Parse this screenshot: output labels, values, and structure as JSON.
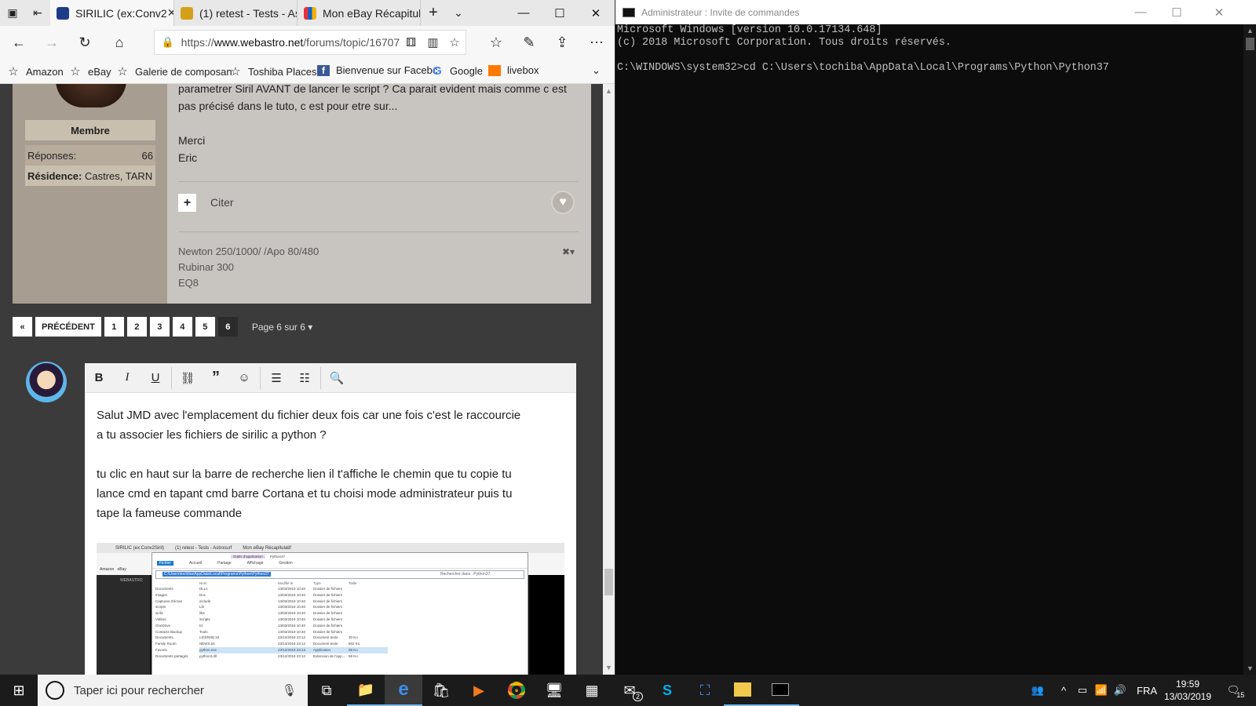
{
  "edge": {
    "tabs": [
      {
        "label": "SIRILIC (ex:Conv2",
        "color": "#1e3a8a"
      },
      {
        "label": "(1) retest - Tests - As",
        "color": "#d4a017"
      },
      {
        "label": "Mon eBay Récapitula",
        "color": "#e53238"
      }
    ],
    "url_prefix": "https://",
    "url_host": "www.webastro.net",
    "url_path": "/forums/topic/16707",
    "favorites": [
      {
        "label": "Amazon",
        "icon": "star-icon"
      },
      {
        "label": "eBay",
        "icon": "star-icon"
      },
      {
        "label": "Galerie de composan",
        "icon": "star-icon"
      },
      {
        "label": "Toshiba Places",
        "icon": "star-icon"
      },
      {
        "label": "Bienvenue sur Facebc",
        "icon": "facebook-icon"
      },
      {
        "label": "Google",
        "icon": "google-icon"
      },
      {
        "label": "livebox",
        "icon": "orange-icon"
      }
    ]
  },
  "post": {
    "role": "Membre",
    "replies_label": "Réponses:",
    "replies_count": "66",
    "residence_label": "Résidence:",
    "residence_value": "Castres, TARN",
    "line1": "parametrer Siril AVANT de lancer le script ? Ca parait evident mais comme c est",
    "line2": "pas précisé dans le tuto, c est pour etre sur...",
    "line3": "Merci",
    "line4": "Eric",
    "citer": "Citer",
    "sig1": "Newton 250/1000/  /Apo 80/480",
    "sig2": "Rubinar 300",
    "sig3": "EQ8"
  },
  "pager": {
    "first": "«",
    "prev": "PRÉCÉDENT",
    "pages": [
      "1",
      "2",
      "3",
      "4",
      "5",
      "6"
    ],
    "current": "6",
    "info": "Page 6 sur 6 ▾"
  },
  "editor": {
    "p1a": "Salut JMD avec l'emplacement du fichier deux fois car une fois c'est le raccourcie",
    "p1b": "a tu associer les fichiers de sirilic a python ?",
    "p2a": "tu clic en haut sur la barre de recherche lien il t'affiche le chemin que tu copie tu",
    "p2b": "lance cmd en tapant cmd barre Cortana et tu choisi mode administrateur puis tu",
    "p2c": "tape la fameuse commande",
    "shot": {
      "tab1": "SIRILIC (ex:Conv2Siril)",
      "tab2": "(1) retest - Tests - Astrosurf",
      "tab3": "Mon eBay Récapitulatif",
      "ribbon": [
        "Fichier",
        "Accueil",
        "Partage",
        "Affichage",
        "Gestion"
      ],
      "tools": "Outils d'application",
      "folder": "Python37",
      "path": "C:\\Users\\tochiba\\AppData\\Local\\Programs\\Python\\Python37",
      "search": "Rechercher dans : Python37",
      "col_name": "Nom",
      "col_date": "Modifié le",
      "col_type": "Type",
      "col_size": "Taille",
      "files": [
        {
          "name": "DLLs",
          "date": "13/03/2019 10:40",
          "type": "Dossier de fichiers",
          "size": ""
        },
        {
          "name": "Doc",
          "date": "13/03/2019 10:40",
          "type": "Dossier de fichiers",
          "size": ""
        },
        {
          "name": "include",
          "date": "13/03/2019 10:40",
          "type": "Dossier de fichiers",
          "size": ""
        },
        {
          "name": "Lib",
          "date": "13/03/2019 10:40",
          "type": "Dossier de fichiers",
          "size": ""
        },
        {
          "name": "libs",
          "date": "13/03/2019 10:40",
          "type": "Dossier de fichiers",
          "size": ""
        },
        {
          "name": "Scripts",
          "date": "13/03/2019 10:40",
          "type": "Dossier de fichiers",
          "size": ""
        },
        {
          "name": "tcl",
          "date": "13/03/2019 10:40",
          "type": "Dossier de fichiers",
          "size": ""
        },
        {
          "name": "Tools",
          "date": "13/03/2019 10:40",
          "type": "Dossier de fichiers",
          "size": ""
        },
        {
          "name": "LICENSE.txt",
          "date": "23/12/2018 23:12",
          "type": "Document texte",
          "size": "30 Ko"
        },
        {
          "name": "NEWS.txt",
          "date": "23/12/2018 23:12",
          "type": "Document texte",
          "size": "602 Ko"
        },
        {
          "name": "python.exe",
          "date": "23/12/2018 23:13",
          "type": "Application",
          "size": "98 Ko"
        },
        {
          "name": "python3.dll",
          "date": "23/12/2018 23:12",
          "type": "Extension de l'app...",
          "size": "58 Ko"
        }
      ],
      "nav": [
        "Documents",
        "Images",
        "Captures d'écran",
        "scripts",
        "sirilic",
        "Vidéos",
        "OneDrive",
        "Contacts Backup",
        "Documents",
        "Family Room",
        "Favoris",
        "Documents partagés"
      ],
      "amazon": "Amazon",
      "ebay": "eBay",
      "site": "WEBASTRO"
    }
  },
  "cmd": {
    "title": "Administrateur : Invite de commandes",
    "l1": "Microsoft Windows [version 10.0.17134.648]",
    "l2": "(c) 2018 Microsoft Corporation. Tous droits réservés.",
    "l3": "",
    "l4": "C:\\WINDOWS\\system32>cd C:\\Users\\tochiba\\AppData\\Local\\Programs\\Python\\Python37"
  },
  "taskbar": {
    "search_placeholder": "Taper ici pour rechercher",
    "lang": "FRA",
    "time": "19:59",
    "date": "13/03/2019",
    "mail_badge": "2",
    "notif_badge": "15"
  }
}
